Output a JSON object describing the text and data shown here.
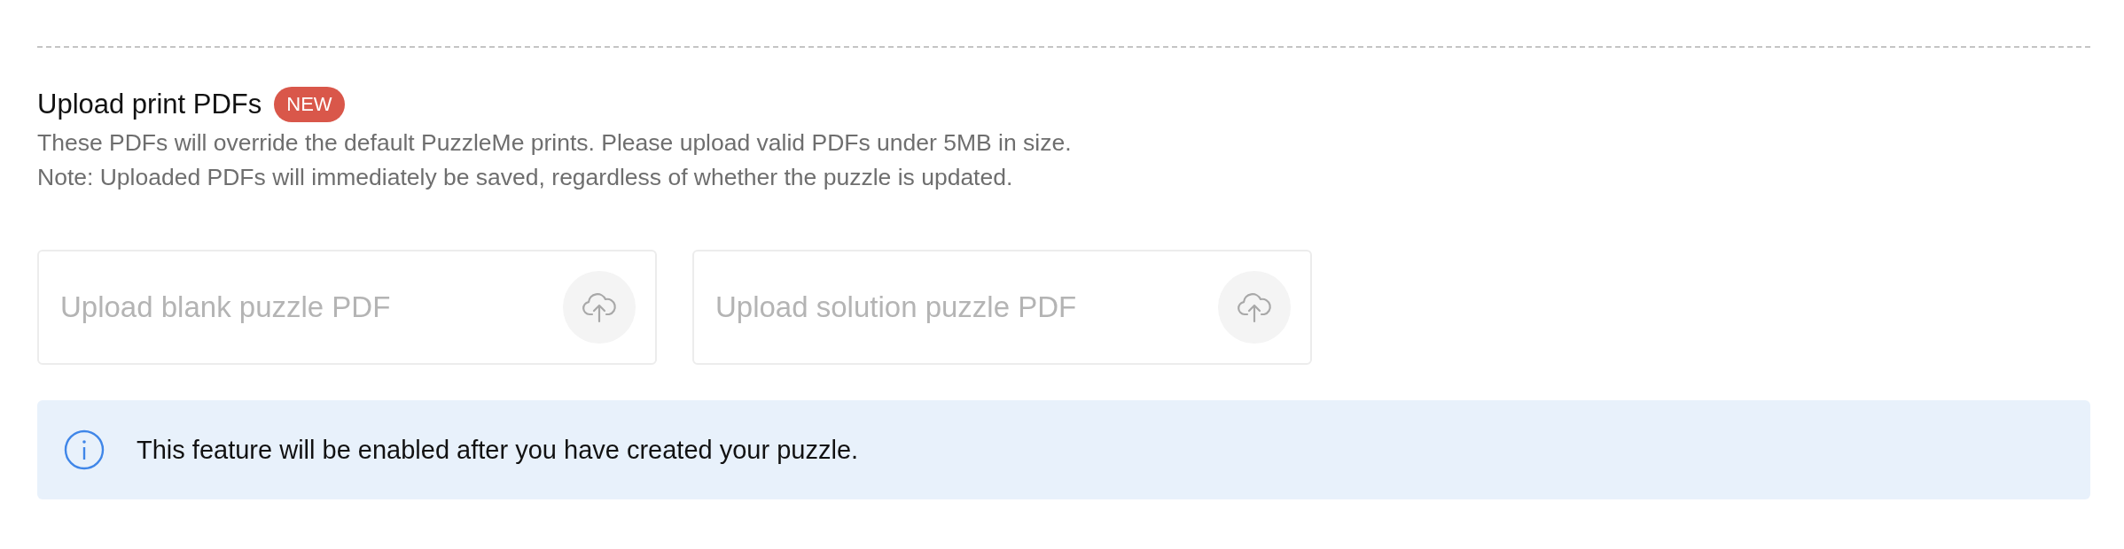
{
  "section": {
    "title": "Upload print PDFs",
    "badge": "NEW",
    "description": [
      "These PDFs will override the default PuzzleMe prints. Please upload valid PDFs under 5MB in size.",
      "Note: Uploaded PDFs will immediately be saved, regardless of whether the puzzle is updated."
    ]
  },
  "uploads": [
    {
      "placeholder": "Upload blank puzzle PDF",
      "disabled": true
    },
    {
      "placeholder": "Upload solution puzzle PDF",
      "disabled": true
    }
  ],
  "notice": {
    "text": "This feature will be enabled after you have created your puzzle."
  }
}
